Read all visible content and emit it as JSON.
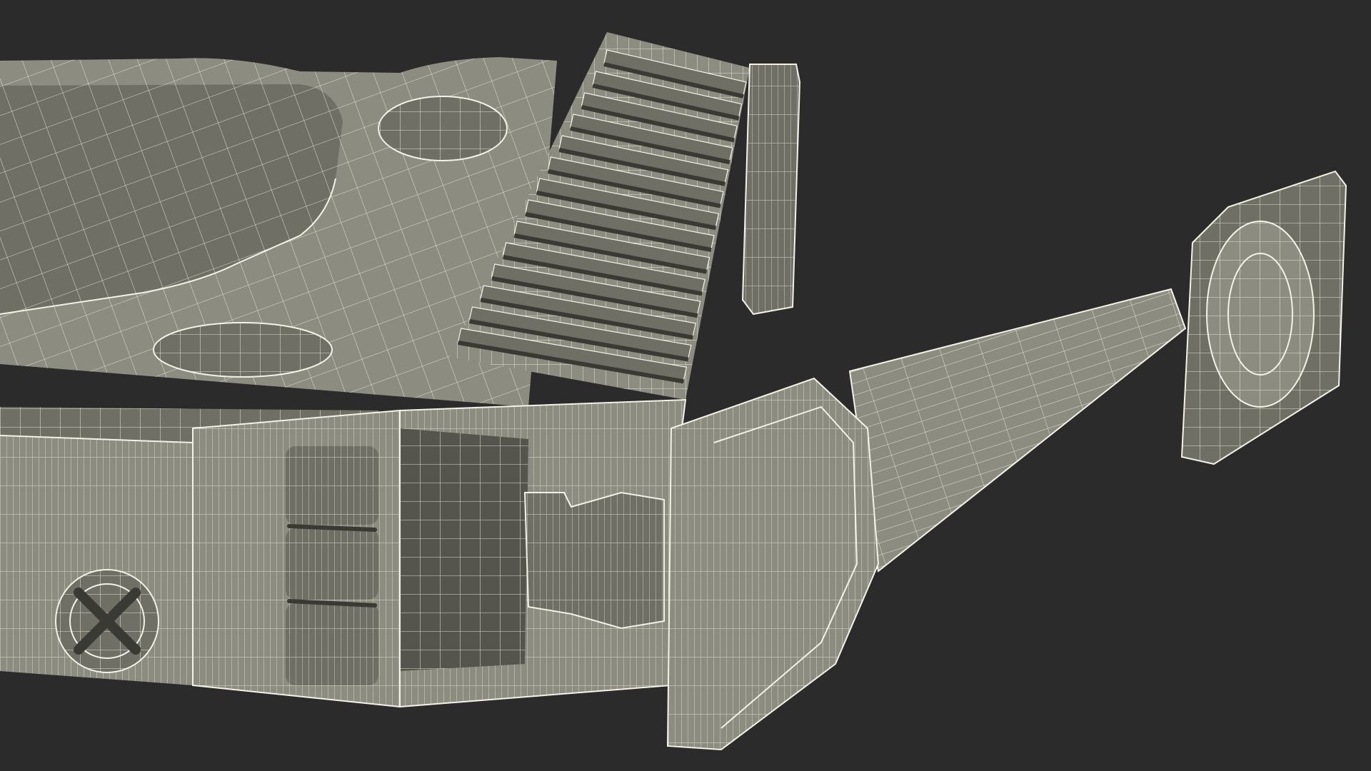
{
  "background_color": "#2b2b2b",
  "surface_color": "#8c8c80",
  "surface_dark": "#6f6f65",
  "surface_shadow": "#55554d",
  "wire_color": "#f4f2e6",
  "groove_color": "#3a3a34",
  "subject": "tape-measure",
  "render_style": "wireframe-on-shaded",
  "components": [
    "housing-body",
    "top-face",
    "oval-recess",
    "grip-ridges",
    "belt-clip",
    "side-screw",
    "hinge-knuckles",
    "tape-mouth",
    "tape-blade",
    "end-hook"
  ]
}
